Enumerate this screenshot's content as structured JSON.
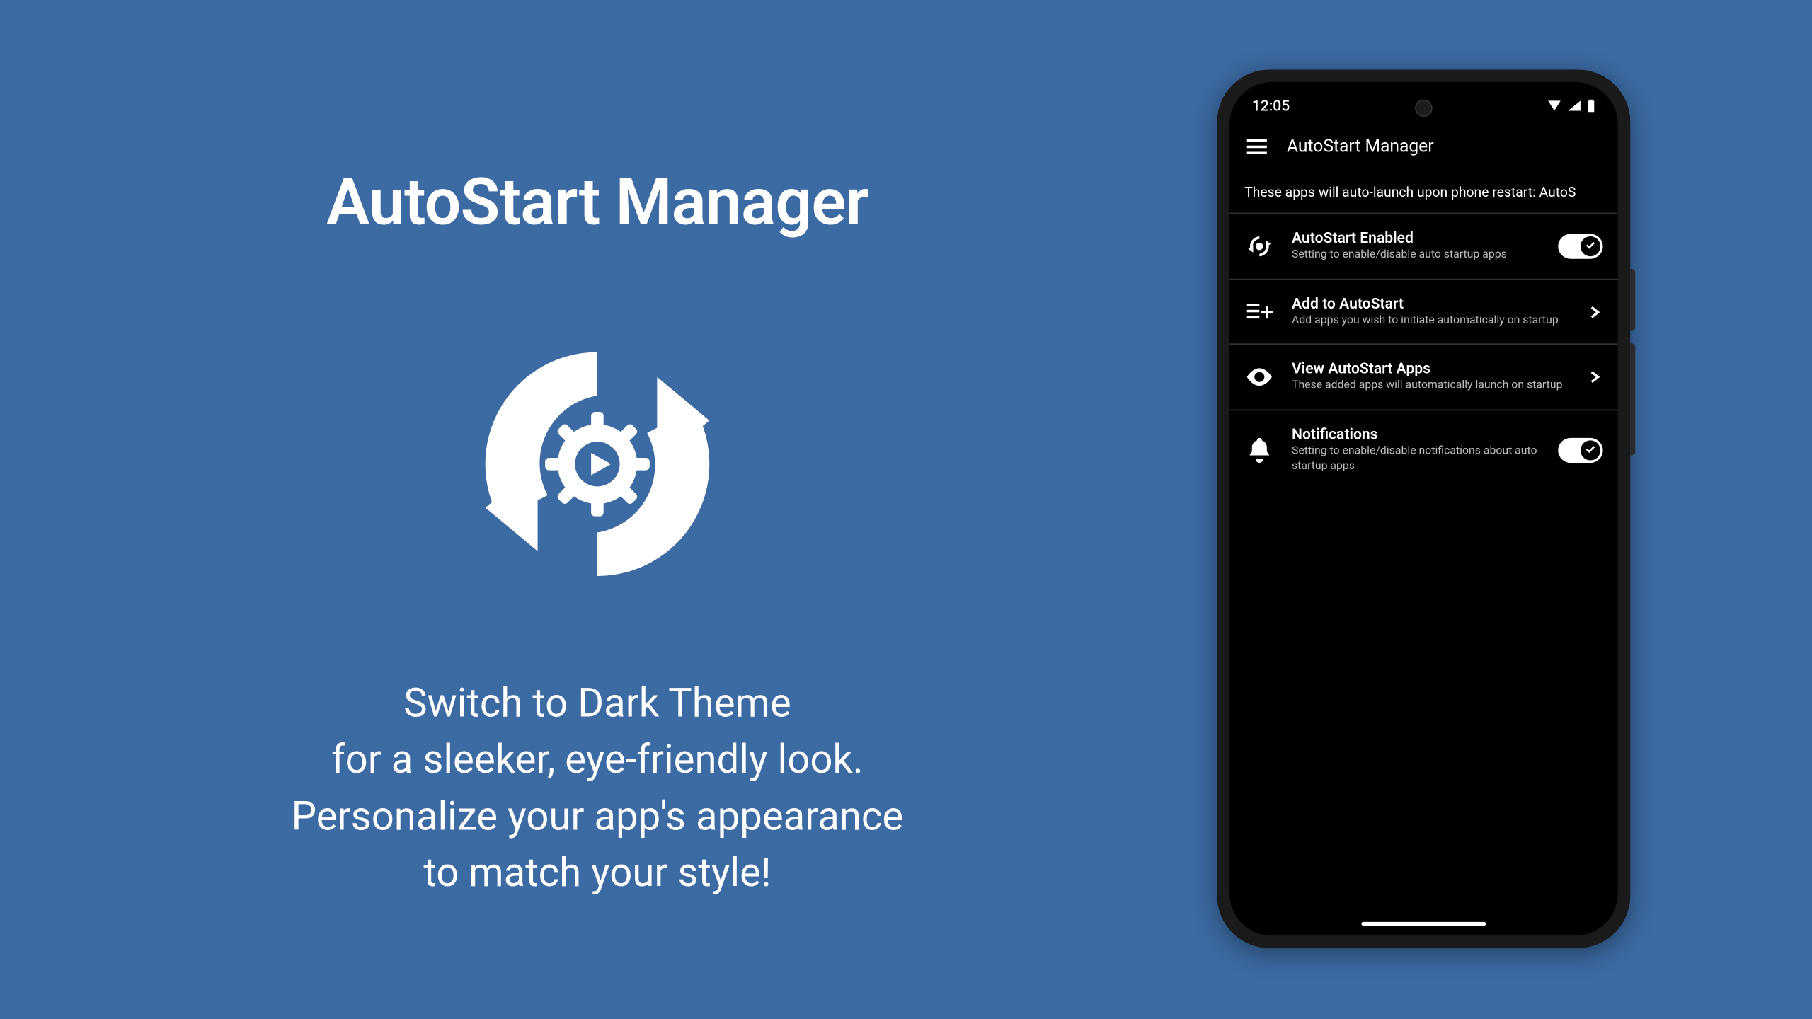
{
  "promo": {
    "title": "AutoStart Manager",
    "desc_line1": "Switch to Dark Theme",
    "desc_line2": "for a sleeker, eye-friendly look.",
    "desc_line3": "Personalize your app's appearance",
    "desc_line4": "to match your style!"
  },
  "phone": {
    "time": "12:05",
    "app_title": "AutoStart Manager",
    "subtitle": "These apps will auto-launch upon phone restart: AutoS",
    "items": [
      {
        "title": "AutoStart Enabled",
        "sub": "Setting to enable/disable auto startup apps"
      },
      {
        "title": "Add to AutoStart",
        "sub": "Add apps you wish to initiate automatically on startup"
      },
      {
        "title": "View AutoStart Apps",
        "sub": "These added apps will automatically launch on startup"
      },
      {
        "title": "Notifications",
        "sub": "Setting to enable/disable notifications about auto startup apps"
      }
    ]
  }
}
